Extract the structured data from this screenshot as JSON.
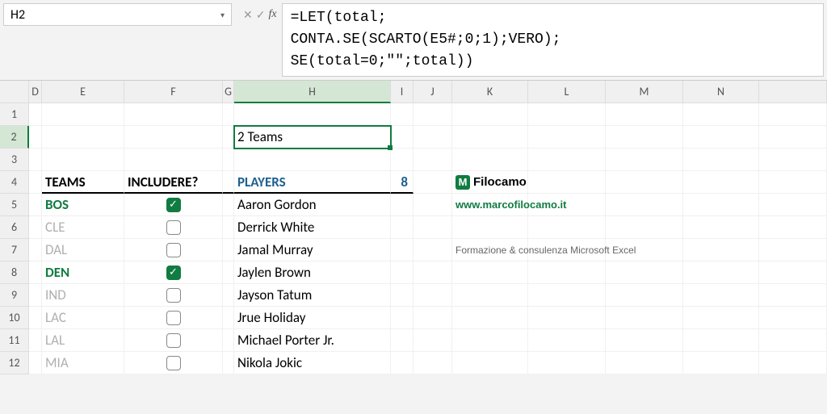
{
  "name_box": "H2",
  "formula": "=LET(total;\nCONTA.SE(SCARTO(E5#;0;1);VERO);\nSE(total=0;\"\";total))",
  "columns": [
    "D",
    "E",
    "F",
    "G",
    "H",
    "I",
    "J",
    "K",
    "L",
    "M",
    "N"
  ],
  "active_col": "H",
  "active_row": "2",
  "headers": {
    "teams": "TEAMS",
    "include": "INCLUDERE?",
    "players": "PLAYERS",
    "count": "8"
  },
  "selected_cell_value": "2 Teams",
  "teams": [
    {
      "code": "BOS",
      "checked": true
    },
    {
      "code": "CLE",
      "checked": false
    },
    {
      "code": "DAL",
      "checked": false
    },
    {
      "code": "DEN",
      "checked": true
    },
    {
      "code": "IND",
      "checked": false
    },
    {
      "code": "LAC",
      "checked": false
    },
    {
      "code": "LAL",
      "checked": false
    },
    {
      "code": "MIA",
      "checked": false
    }
  ],
  "players": [
    "Aaron Gordon",
    "Derrick White",
    "Jamal Murray",
    "Jaylen Brown",
    "Jayson Tatum",
    "Jrue Holiday",
    "Michael Porter Jr.",
    "Nikola Jokic"
  ],
  "brand": {
    "name": "Filocamo",
    "url": "www.marcofilocamo.it",
    "tagline": "Formazione & consulenza Microsoft Excel"
  },
  "chart_data": {
    "type": "table",
    "title": "Teams / Players filter",
    "columns": [
      "TEAMS",
      "INCLUDERE?",
      "PLAYERS"
    ],
    "rows": [
      [
        "BOS",
        true,
        "Aaron Gordon"
      ],
      [
        "CLE",
        false,
        "Derrick White"
      ],
      [
        "DAL",
        false,
        "Jamal Murray"
      ],
      [
        "DEN",
        true,
        "Jaylen Brown"
      ],
      [
        "IND",
        false,
        "Jayson Tatum"
      ],
      [
        "LAC",
        false,
        "Jrue Holiday"
      ],
      [
        "LAL",
        false,
        "Michael Porter Jr."
      ],
      [
        "MIA",
        false,
        "Nikola Jokic"
      ]
    ],
    "player_count": 8,
    "team_count_label": "2 Teams"
  }
}
